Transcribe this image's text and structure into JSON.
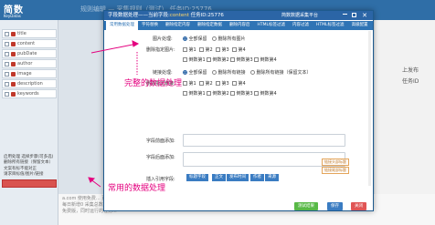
{
  "app": {
    "logo_text": "简数",
    "logo_sub": "KeyDatas",
    "bg_title": "规则编辑 — 采集规则（测试）  任务ID:25776"
  },
  "sidebar": {
    "items": [
      "title",
      "content",
      "pubDate",
      "author",
      "image",
      "description",
      "keywords"
    ],
    "options_text": [
      "启用处理 选择步骤(可多选)",
      "删除所有链接（保留文本）",
      "文案有标不能对正",
      "请求目标值/图片/链接"
    ]
  },
  "bottom_text": [
    "a.com 使用免费... 更多请见说明...",
    "每日新增0 采集总数 0 ...",
    "免费版，同时运行的任务..."
  ],
  "right_text": [
    "上发布",
    "任务ID"
  ],
  "modal": {
    "title": "字段数据处理——当前字段:",
    "field": "content",
    "task": "任务ID:25776",
    "brand": "简数数据采集平台",
    "close_glyph": "✕",
    "tabs": [
      "常用数据处理",
      "字符替换",
      "删除指定内容",
      "删除指定数据",
      "删除内容后",
      "HTML标签过滤",
      "内容过滤",
      "HTML标签过滤",
      "高级配置"
    ],
    "img_label": "图片处理:",
    "img_options": [
      "全部保留",
      "删除所有图片"
    ],
    "del_img_label": "删除指定图片:",
    "del_img_options": [
      "第1",
      "第2",
      "第3",
      "第4"
    ],
    "del_img_options2": [
      "倒数第1",
      "倒数第2",
      "倒数第3",
      "倒数第4"
    ],
    "link_label": "链接处理:",
    "link_options": [
      "全部保留",
      "删除所有链接",
      "删除所有链接（保留文本）"
    ],
    "del_link_label": "删除指定链接:",
    "del_link_options": [
      "第1",
      "第2",
      "第3",
      "第4"
    ],
    "del_link_options2": [
      "倒数第1",
      "倒数第2",
      "倒数第3",
      "倒数第4"
    ],
    "prefix_label": "字段前面添加:",
    "suffix_label": "字段后面添加:",
    "insert_label": "插入引用字段:",
    "link_btn_1": "链接头部标题",
    "link_btn_2": "链接尾部标题",
    "insert_btns": [
      "标题字段",
      "正文",
      "发布时间",
      "作者",
      "来源"
    ],
    "btn_test": "测试结果",
    "btn_save": "保存",
    "btn_close": "关闭"
  },
  "annotations": {
    "full_processing": "完整的数据处理",
    "common_processing": "常用的数据处理"
  },
  "colors": {
    "accent": "#2b65a6",
    "annotation": "#e4007f",
    "test_btn": "#58b947",
    "save_btn": "#3a7cc2",
    "close_btn": "#e05555"
  }
}
